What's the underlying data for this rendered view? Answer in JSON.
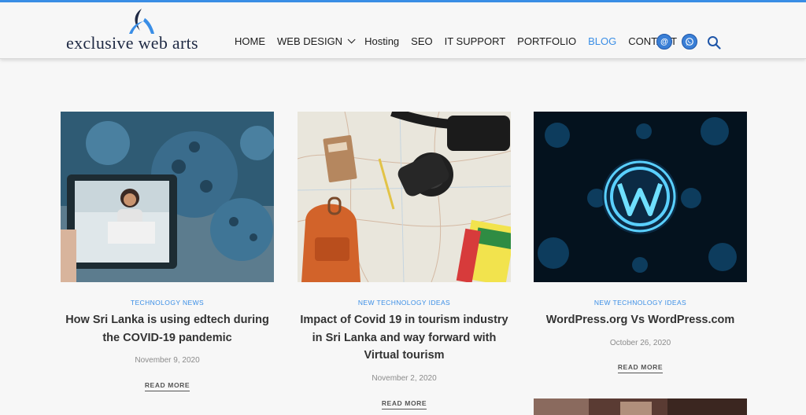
{
  "brand": {
    "logo_text": "exclusive web arts"
  },
  "nav": {
    "items": [
      {
        "label": "HOME"
      },
      {
        "label": "WEB DESIGN"
      },
      {
        "label": "Hosting"
      },
      {
        "label": "SEO"
      },
      {
        "label": "IT SUPPORT"
      },
      {
        "label": "PORTFOLIO"
      },
      {
        "label": "BLOG"
      },
      {
        "label": "CONTACT"
      }
    ],
    "active": "BLOG",
    "email_icon_glyph": "@",
    "whatsapp_icon": "whatsapp-icon",
    "search_icon": "search-icon"
  },
  "colors": {
    "accent": "#3a8ee6",
    "title": "#333333",
    "meta": "#8b8b8b"
  },
  "posts": [
    {
      "category": "TECHNOLOGY NEWS",
      "title": "How Sri Lanka is using edtech during the COVID-19 pandemic",
      "date": "November 9, 2020",
      "read_more": "READ MORE"
    },
    {
      "category": "NEW TECHNOLOGY IDEAS",
      "title": "Impact of Covid 19 in tourism industry in Sri Lanka and way forward with Virtual tourism",
      "date": "November 2, 2020",
      "read_more": "READ MORE"
    },
    {
      "category": "NEW TECHNOLOGY IDEAS",
      "title": "WordPress.org Vs WordPress.com",
      "date": "October 26, 2020",
      "read_more": "READ MORE"
    }
  ]
}
